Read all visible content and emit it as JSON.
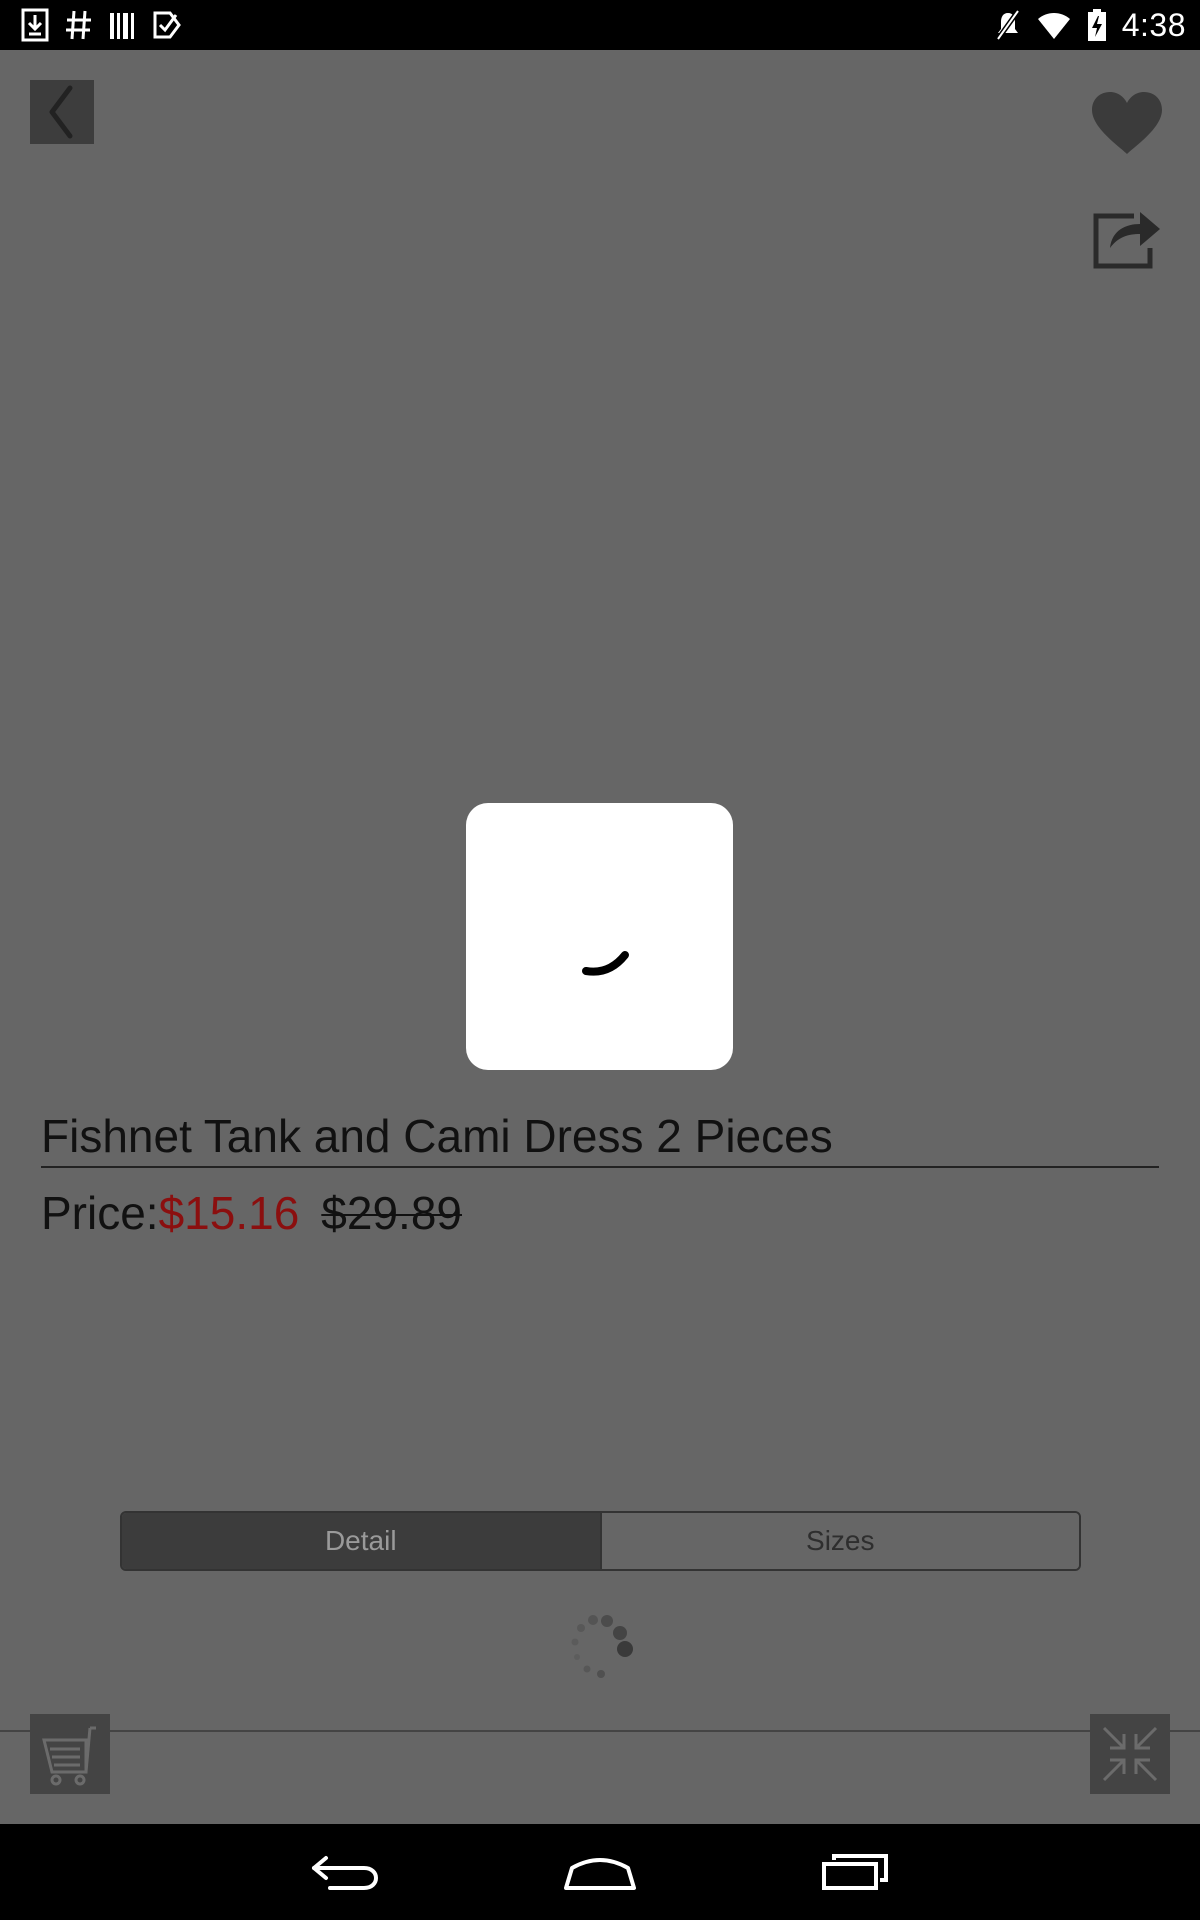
{
  "status_bar": {
    "time": "4:38",
    "left_icons": [
      "download-icon",
      "hash-icon",
      "barcode-icon",
      "checkbox-icon"
    ],
    "right_icons": [
      "mute-icon",
      "wifi-icon",
      "battery-charging-icon"
    ]
  },
  "header": {
    "back_icon": "chevron-left-icon",
    "favorite_icon": "heart-icon",
    "share_icon": "share-icon"
  },
  "product": {
    "title": "Fishnet Tank and Cami Dress 2 Pieces",
    "price_label": "Price:",
    "price_current": "$15.16",
    "price_original": "$29.89"
  },
  "tabs": [
    {
      "label": "Detail",
      "selected": true
    },
    {
      "label": "Sizes",
      "selected": false
    }
  ],
  "footer": {
    "cart_icon": "cart-icon",
    "collapse_icon": "collapse-icon"
  },
  "nav_bar": {
    "buttons": [
      "back-nav-icon",
      "home-nav-icon",
      "recents-nav-icon"
    ]
  },
  "colors": {
    "overlay_background": "#666666",
    "sale_price": "#8b0f0f",
    "dialog": "#ffffff"
  }
}
